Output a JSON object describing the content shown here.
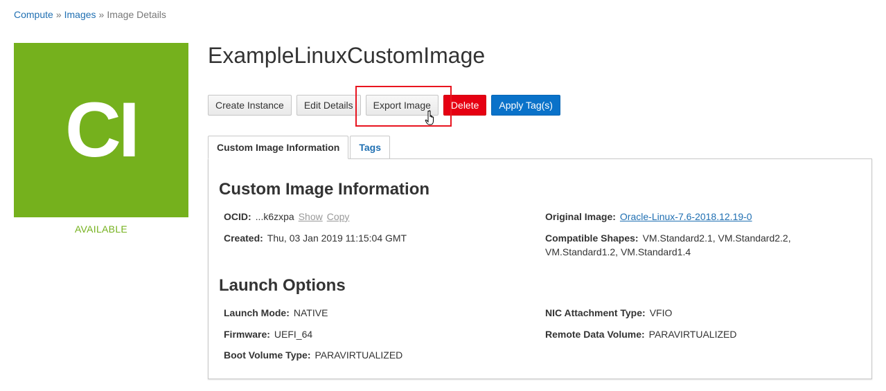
{
  "breadcrumb": {
    "items": [
      {
        "label": "Compute"
      },
      {
        "label": "Images"
      }
    ],
    "separator": "»",
    "current": "Image Details"
  },
  "image": {
    "initials": "CI",
    "status": "AVAILABLE",
    "badge_color": "#75b11d"
  },
  "page_title": "ExampleLinuxCustomImage",
  "actions": {
    "create_instance": "Create Instance",
    "edit_details": "Edit Details",
    "export_image": "Export Image",
    "delete": "Delete",
    "apply_tags": "Apply Tag(s)"
  },
  "tabs": [
    {
      "label": "Custom Image Information",
      "active": true
    },
    {
      "label": "Tags",
      "active": false
    }
  ],
  "info": {
    "heading": "Custom Image Information",
    "ocid_label": "OCID:",
    "ocid_value": "...k6zxpa",
    "show_link": "Show",
    "copy_link": "Copy",
    "created_label": "Created:",
    "created_value": "Thu, 03 Jan 2019 11:15:04 GMT",
    "original_image_label": "Original Image:",
    "original_image_value": "Oracle-Linux-7.6-2018.12.19-0",
    "compatible_shapes_label": "Compatible Shapes:",
    "compatible_shapes_line1": "VM.Standard2.1, VM.Standard2.2,",
    "compatible_shapes_line2": "VM.Standard1.2, VM.Standard1.4"
  },
  "launch": {
    "heading": "Launch Options",
    "launch_mode_label": "Launch Mode:",
    "launch_mode_value": "NATIVE",
    "firmware_label": "Firmware:",
    "firmware_value": "UEFI_64",
    "boot_volume_type_label": "Boot Volume Type:",
    "boot_volume_type_value": "PARAVIRTUALIZED",
    "nic_attachment_type_label": "NIC Attachment Type:",
    "nic_attachment_type_value": "VFIO",
    "remote_data_volume_label": "Remote Data Volume:",
    "remote_data_volume_value": "PARAVIRTUALIZED"
  },
  "colors": {
    "link": "#1f6fb2",
    "danger": "#e60012",
    "primary": "#0a72c9",
    "highlight": "#e8141f"
  },
  "icons": {
    "cursor": "hand-pointer-icon"
  }
}
